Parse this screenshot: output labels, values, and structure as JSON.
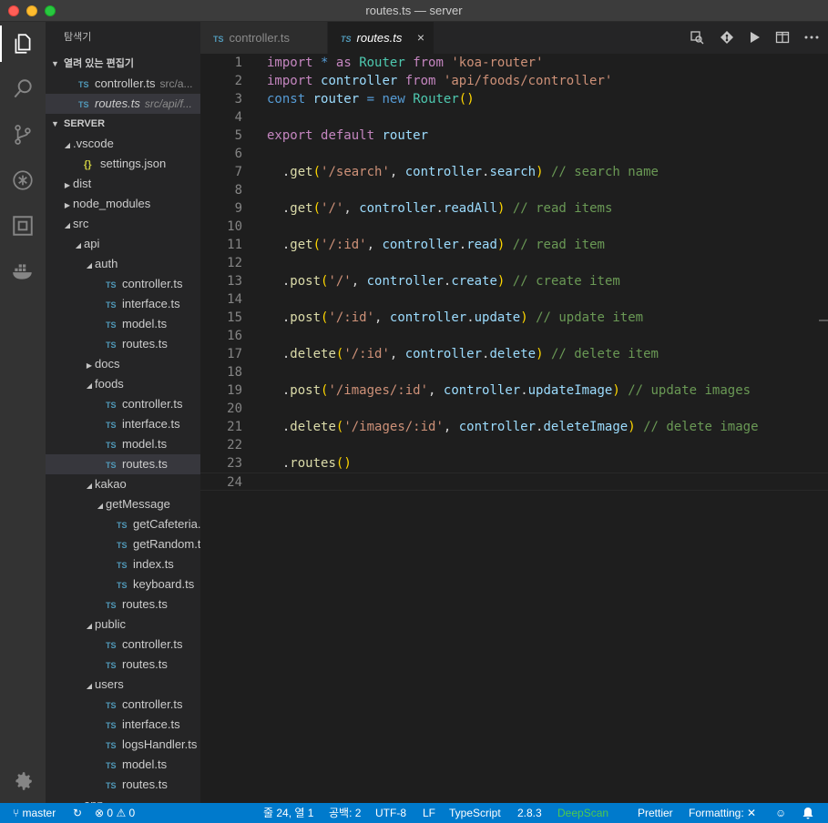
{
  "window": {
    "title": "routes.ts — server"
  },
  "sidebar": {
    "title": "탐색기",
    "open_editors": {
      "header": "열려 있는 편집기",
      "items": [
        {
          "badge": "TS",
          "name": "controller.ts",
          "path": "src/a..."
        },
        {
          "badge": "TS",
          "name": "routes.ts",
          "path": "src/api/f..."
        }
      ]
    },
    "project": {
      "header": "SERVER",
      "tree": [
        {
          "name": ".vscode",
          "type": "folder-open"
        },
        {
          "name": "settings.json",
          "type": "json"
        },
        {
          "name": "dist",
          "type": "folder"
        },
        {
          "name": "node_modules",
          "type": "folder"
        },
        {
          "name": "src",
          "type": "folder-open"
        },
        {
          "name": "api",
          "type": "folder-open"
        },
        {
          "name": "auth",
          "type": "folder-open"
        },
        {
          "name": "controller.ts",
          "type": "ts"
        },
        {
          "name": "interface.ts",
          "type": "ts"
        },
        {
          "name": "model.ts",
          "type": "ts"
        },
        {
          "name": "routes.ts",
          "type": "ts"
        },
        {
          "name": "docs",
          "type": "folder"
        },
        {
          "name": "foods",
          "type": "folder-open"
        },
        {
          "name": "controller.ts",
          "type": "ts"
        },
        {
          "name": "interface.ts",
          "type": "ts"
        },
        {
          "name": "model.ts",
          "type": "ts"
        },
        {
          "name": "routes.ts",
          "type": "ts"
        },
        {
          "name": "kakao",
          "type": "folder-open"
        },
        {
          "name": "getMessage",
          "type": "folder-open"
        },
        {
          "name": "getCafeteria...",
          "type": "ts"
        },
        {
          "name": "getRandom.ts",
          "type": "ts"
        },
        {
          "name": "index.ts",
          "type": "ts"
        },
        {
          "name": "keyboard.ts",
          "type": "ts"
        },
        {
          "name": "routes.ts",
          "type": "ts"
        },
        {
          "name": "public",
          "type": "folder-open"
        },
        {
          "name": "controller.ts",
          "type": "ts"
        },
        {
          "name": "routes.ts",
          "type": "ts"
        },
        {
          "name": "users",
          "type": "folder-open"
        },
        {
          "name": "controller.ts",
          "type": "ts"
        },
        {
          "name": "interface.ts",
          "type": "ts"
        },
        {
          "name": "logsHandler.ts",
          "type": "ts"
        },
        {
          "name": "model.ts",
          "type": "ts"
        },
        {
          "name": "routes.ts",
          "type": "ts"
        },
        {
          "name": "app",
          "type": "folder"
        }
      ]
    }
  },
  "tabs": [
    {
      "badge": "TS",
      "label": "controller.ts",
      "active": false
    },
    {
      "badge": "TS",
      "label": "routes.ts",
      "active": true,
      "close": "×"
    }
  ],
  "editor": {
    "line_numbers": [
      "1",
      "2",
      "3",
      "4",
      "5",
      "6",
      "7",
      "8",
      "9",
      "10",
      "11",
      "12",
      "13",
      "14",
      "15",
      "16",
      "17",
      "18",
      "19",
      "20",
      "21",
      "22",
      "23",
      "24"
    ],
    "lines": [
      "import * as Router from 'koa-router'",
      "import controller from 'api/foods/controller'",
      "const router = new Router()",
      "",
      "export default router",
      "",
      "  .get('/search', controller.search) // search name",
      "",
      "  .get('/', controller.readAll) // read items",
      "",
      "  .get('/:id', controller.read) // read item",
      "",
      "  .post('/', controller.create) // create item",
      "",
      "  .post('/:id', controller.update) // update item",
      "",
      "  .delete('/:id', controller.delete) // delete item",
      "",
      "  .post('/images/:id', controller.updateImage) // update images",
      "",
      "  .delete('/images/:id', controller.deleteImage) // delete image",
      "",
      "  .routes()",
      ""
    ]
  },
  "statusbar": {
    "branch": "master",
    "errors": "0",
    "warnings": "0",
    "position": "줄 24, 열 1",
    "spaces": "공백: 2",
    "encoding": "UTF-8",
    "eol": "LF",
    "language": "TypeScript",
    "version": "2.8.3",
    "deepscan": "DeepScan",
    "prettier": "Prettier",
    "formatting": "Formatting: ✕",
    "deepscan_color": "#4ec94e"
  }
}
